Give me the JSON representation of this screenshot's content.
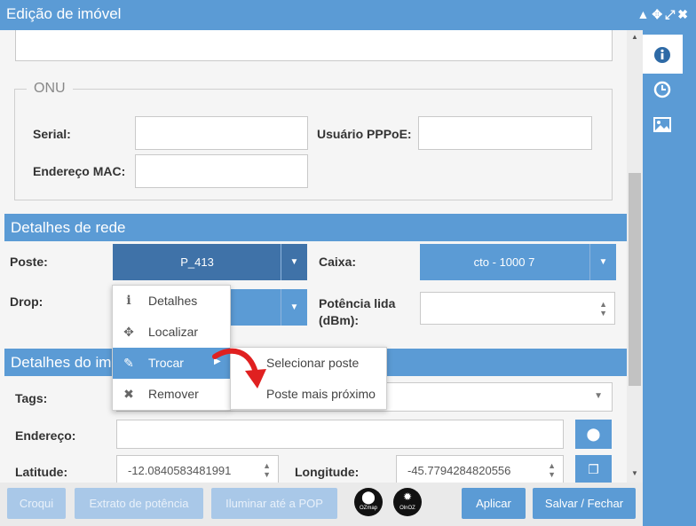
{
  "window": {
    "title": "Edição de imóvel"
  },
  "onu": {
    "legend": "ONU",
    "serial_label": "Serial:",
    "pppoe_label": "Usuário PPPoE:",
    "mac_label": "Endereço MAC:"
  },
  "rede": {
    "header": "Detalhes de rede",
    "poste_label": "Poste:",
    "poste_value": "P_413",
    "caixa_label": "Caixa:",
    "caixa_value": "cto - 1000 7",
    "drop_label": "Drop:",
    "potencia_label_1": "Potência lida",
    "potencia_label_2": "(dBm):"
  },
  "imovel": {
    "header": "Detalhes do imóvel",
    "tags_label": "Tags:",
    "endereco_label": "Endereço:",
    "latitude_label": "Latitude:",
    "latitude_value": "-12.0840583481991",
    "longitude_label": "Longitude:",
    "longitude_value": "-45.7794284820556"
  },
  "context_menu": {
    "items": [
      {
        "label": "Detalhes",
        "icon": "info-icon"
      },
      {
        "label": "Localizar",
        "icon": "crosshair-icon"
      },
      {
        "label": "Trocar",
        "icon": "edit-icon"
      },
      {
        "label": "Remover",
        "icon": "x-icon"
      }
    ],
    "submenu": [
      {
        "label": "Selecionar poste"
      },
      {
        "label": "Poste mais próximo"
      }
    ]
  },
  "footer": {
    "croqui": "Croqui",
    "extrato": "Extrato de potência",
    "iluminar": "Iluminar até a POP",
    "ozmap_label": "OZmap",
    "olozma_label": "OlnOZ",
    "aplicar": "Aplicar",
    "salvar": "Salvar / Fechar"
  },
  "colors": {
    "accent": "#5b9bd5",
    "selected": "#3f72a8",
    "arrow": "#e02020"
  }
}
